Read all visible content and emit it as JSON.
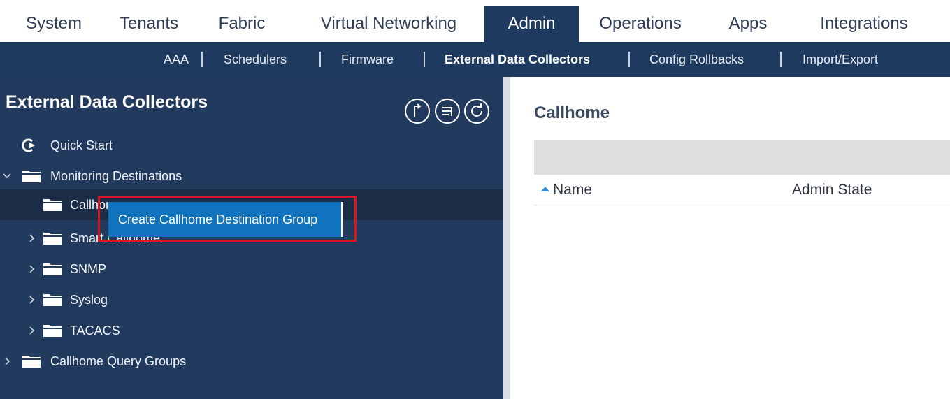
{
  "topnav": {
    "tabs": [
      {
        "label": "System"
      },
      {
        "label": "Tenants"
      },
      {
        "label": "Fabric"
      },
      {
        "label": "Virtual Networking"
      },
      {
        "label": "Admin",
        "active": true
      },
      {
        "label": "Operations"
      },
      {
        "label": "Apps"
      },
      {
        "label": "Integrations"
      }
    ]
  },
  "subnav": {
    "items": [
      {
        "label": "AAA"
      },
      {
        "label": "Schedulers"
      },
      {
        "label": "Firmware"
      },
      {
        "label": "External Data Collectors",
        "active": true
      },
      {
        "label": "Config Rollbacks"
      },
      {
        "label": "Import/Export"
      }
    ]
  },
  "left_panel": {
    "title": "External Data Collectors",
    "actions": [
      "upload-icon",
      "list-icon",
      "refresh-icon"
    ],
    "tree": [
      {
        "label": "Quick Start",
        "icon": "play-icon"
      },
      {
        "label": "Monitoring Destinations",
        "expanded": true
      },
      {
        "label": "Callhome",
        "selected": true
      },
      {
        "label": "Smart Callhome"
      },
      {
        "label": "SNMP"
      },
      {
        "label": "Syslog"
      },
      {
        "label": "TACACS"
      },
      {
        "label": "Callhome Query Groups"
      }
    ]
  },
  "context_menu": {
    "item_label": "Create Callhome Destination Group"
  },
  "right_panel": {
    "title": "Callhome",
    "columns": [
      {
        "label": "Name",
        "sorted": "ascending"
      },
      {
        "label": "Admin State"
      }
    ]
  },
  "colors": {
    "nav_dark": "#1e3a5e",
    "panel_bg": "#213a5e",
    "selected_row": "#1a2c46",
    "menu_blue": "#0f74bd",
    "highlight_red": "#e0141e",
    "sort_arrow": "#2f88d8"
  }
}
